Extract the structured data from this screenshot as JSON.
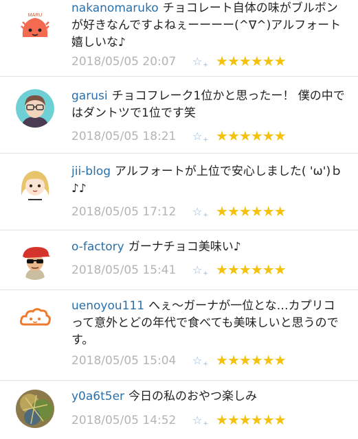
{
  "comments": [
    {
      "user": "nakanomaruko",
      "text": "チョコレート自体の味がブルボンが好きなんですよねぇーーーー(^∇^)アルフォート嬉しいな♪",
      "timestamp": "2018/05/05 20:07",
      "rating": 6,
      "avatar_icon": "maru-character-icon",
      "avatar_label": "MARU"
    },
    {
      "user": "garusi",
      "text": "チョコフレーク1位かと思ったー！ 僕の中ではダントツで1位です笑",
      "timestamp": "2018/05/05 18:21",
      "rating": 6,
      "avatar_icon": "glasses-person-icon"
    },
    {
      "user": "jii-blog",
      "text": "アルフォートが上位で安心しました( 'ω')ｂ♪♪",
      "timestamp": "2018/05/05 17:12",
      "rating": 6,
      "avatar_icon": "blonde-girl-icon"
    },
    {
      "user": "o-factory",
      "text": "ガーナチョコ美味い♪",
      "timestamp": "2018/05/05 15:41",
      "rating": 6,
      "avatar_icon": "sunglasses-man-icon"
    },
    {
      "user": "uenoyou111",
      "text": "へぇ～ガーナが一位とな…カプリコって意外とどの年代で食べても美味しいと思うのです。",
      "timestamp": "2018/05/05 15:04",
      "rating": 6,
      "avatar_icon": "orange-cloud-icon"
    },
    {
      "user": "y0a6t5er",
      "text": "今日の私のおやつ楽しみ",
      "timestamp": "2018/05/05 14:52",
      "rating": 6,
      "avatar_icon": "photo-thumbnail-icon"
    }
  ],
  "add_star_label": "☆",
  "add_star_plus": "+",
  "star_glyph": "★",
  "colors": {
    "username": "#2a6fa8",
    "timestamp": "#b4b4b4",
    "star": "#f4c10b",
    "add_star": "#8fb6dc",
    "separator": "#e3e3e3"
  }
}
